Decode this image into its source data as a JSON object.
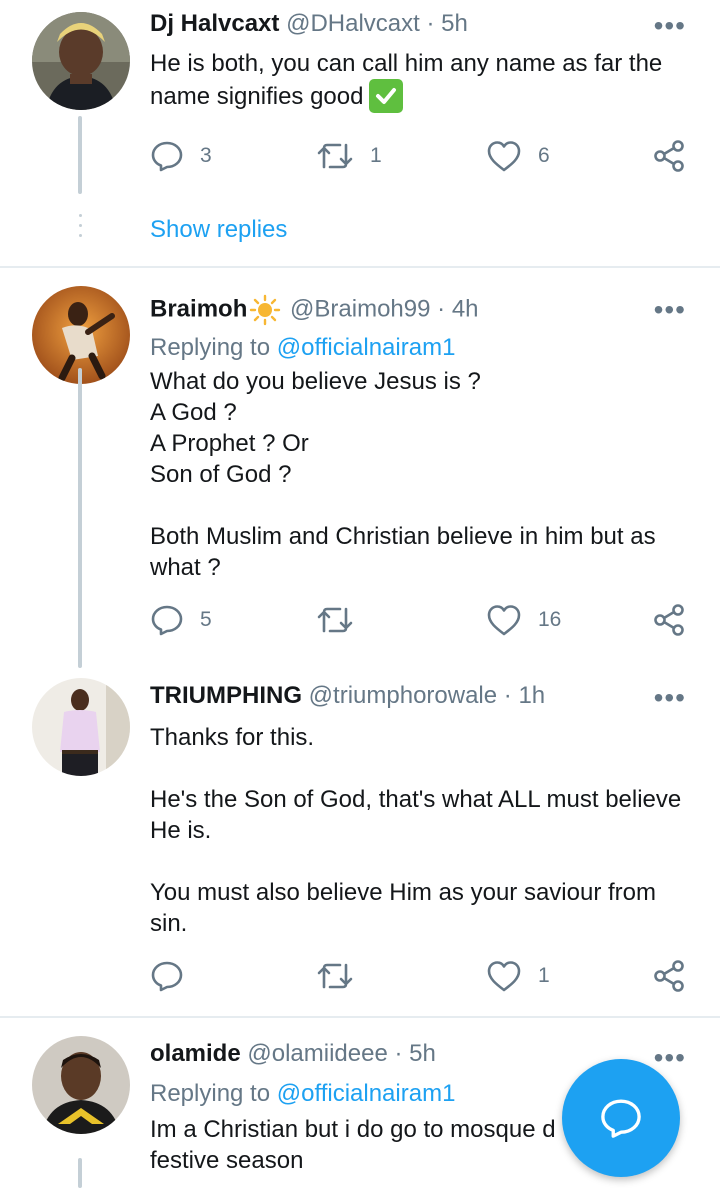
{
  "tweets": [
    {
      "name": "Dj Halvcaxt",
      "handle": "@DHalvcaxt",
      "sep": "·",
      "time": "5h",
      "body": "He is both, you can call him any name as far the name signifies good",
      "body_emoji": "check-mark-button",
      "replies": "3",
      "retweets": "1",
      "likes": "6",
      "show_replies": "Show replies"
    },
    {
      "name": "Braimoh",
      "name_emoji": "sun",
      "handle": "@Braimoh99",
      "sep": "·",
      "time": "4h",
      "replying_prefix": "Replying to",
      "replying_to": "@officialnairam1",
      "body": "What do you believe Jesus is ?\nA God ?\nA Prophet ? Or\nSon of God ?\n\nBoth Muslim and Christian believe in him but as what ?",
      "replies": "5",
      "retweets": "",
      "likes": "16"
    },
    {
      "name": "TRIUMPHING",
      "handle": "@triumphorowale",
      "sep": "·",
      "time": "1h",
      "body": "Thanks for this.\n\nHe's the Son of God, that's what ALL must believe He is.\n\nYou must also believe Him as your saviour from sin.",
      "replies": "",
      "retweets": "",
      "likes": "1"
    },
    {
      "name": "olamide",
      "handle": "@olamiideee",
      "sep": "·",
      "time": "5h",
      "replying_prefix": "Replying to",
      "replying_to": "@officialnairam1",
      "body": "Im a Christian but i do go to mosque d\nfestive season"
    }
  ],
  "more_glyph": "•••",
  "icons": {
    "reply": "reply-icon",
    "retweet": "retweet-icon",
    "like": "heart-icon",
    "share": "share-icon",
    "compose": "compose-reply-icon"
  },
  "colors": {
    "accent": "#1da1f2",
    "secondary_text": "#657786",
    "thread_line": "#c4cfd6",
    "divider": "#e6ecf0"
  }
}
